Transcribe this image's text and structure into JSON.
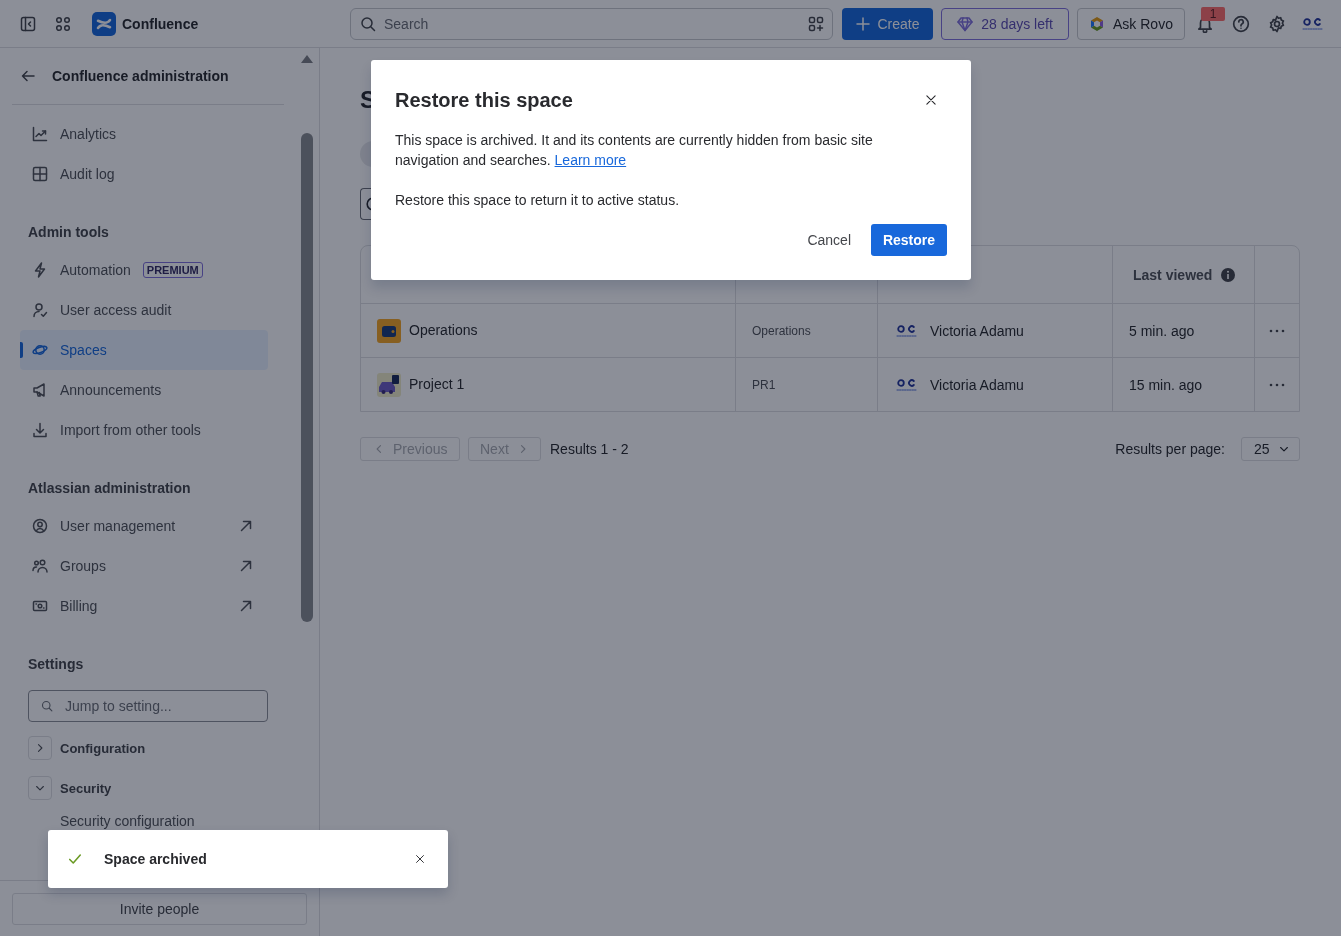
{
  "top_bar": {
    "product_name": "Confluence",
    "search": {
      "placeholder": "Search"
    },
    "create_button": "Create",
    "trial_button": "28 days left",
    "rovo_button": "Ask Rovo",
    "notification_count": "1"
  },
  "sidebar": {
    "title": "Confluence administration",
    "sections": [
      {
        "items": [
          {
            "label": "Analytics",
            "selected": false,
            "external": false
          },
          {
            "label": "Audit log",
            "selected": false,
            "external": false
          }
        ]
      },
      {
        "heading": "Admin tools",
        "items": [
          {
            "label": "Automation",
            "badge": "PREMIUM",
            "selected": false,
            "external": false
          },
          {
            "label": "User access audit",
            "selected": false,
            "external": false
          },
          {
            "label": "Spaces",
            "selected": true,
            "external": false
          },
          {
            "label": "Announcements",
            "selected": false,
            "external": false
          },
          {
            "label": "Import from other tools",
            "selected": false,
            "external": false
          }
        ]
      },
      {
        "heading": "Atlassian administration",
        "items": [
          {
            "label": "User management",
            "selected": false,
            "external": true
          },
          {
            "label": "Groups",
            "selected": false,
            "external": true
          },
          {
            "label": "Billing",
            "selected": false,
            "external": true
          }
        ]
      }
    ],
    "settings": {
      "heading": "Settings",
      "search": {
        "placeholder": "Jump to setting..."
      },
      "groups": [
        {
          "label": "Configuration",
          "expanded": false
        },
        {
          "label": "Security",
          "expanded": true,
          "children": [
            {
              "label": "Security configuration"
            }
          ]
        }
      ]
    },
    "footer_button": "Invite people"
  },
  "main": {
    "title": "S",
    "table": {
      "last_viewed_header": "Last viewed",
      "rows": [
        {
          "column_1": "Operations",
          "column_2": "Operations",
          "column_3": "Victoria Adamu",
          "last_viewed": "5 min. ago"
        },
        {
          "column_1": "Project 1",
          "column_2": "PR1",
          "column_3": "Victoria Adamu",
          "last_viewed": "15 min. ago"
        }
      ]
    },
    "pagination": {
      "previous": {
        "label": "Previous",
        "disabled": true
      },
      "next": {
        "label": "Next",
        "disabled": true
      },
      "results": "Results 1 - 2",
      "per_page_label": "Results per page:",
      "per_page": "25"
    }
  },
  "dialog": {
    "title": "Restore this space",
    "body": "This space is archived. It and its contents are currently hidden from basic site navigation and searches.",
    "link": "Learn more",
    "note": "Restore this space to return it to active status.",
    "cancel_button": "Cancel",
    "confirm_button": "Restore"
  },
  "toast": {
    "message": "Space archived"
  }
}
